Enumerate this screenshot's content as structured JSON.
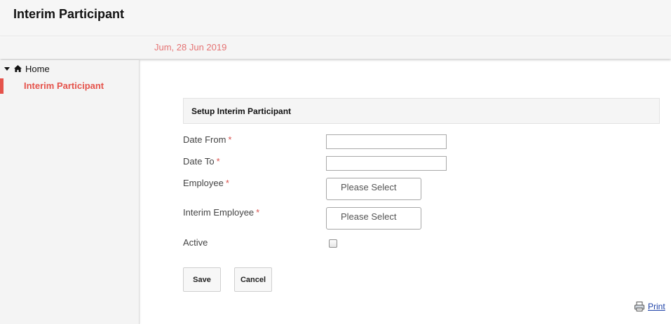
{
  "header": {
    "title": "Interim Participant"
  },
  "subheader": {
    "date": "Jum, 28 Jun 2019"
  },
  "sidebar": {
    "home_label": "Home",
    "items": [
      {
        "label": "Interim Participant",
        "active": true
      }
    ]
  },
  "form": {
    "title": "Setup Interim Participant",
    "required_mark": "*",
    "fields": {
      "date_from": {
        "label": "Date From",
        "value": ""
      },
      "date_to": {
        "label": "Date To",
        "value": ""
      },
      "employee": {
        "label": "Employee",
        "value": "Please Select"
      },
      "interim_employee": {
        "label": "Interim Employee",
        "value": "Please Select"
      },
      "active": {
        "label": "Active",
        "checked": false
      }
    },
    "save_label": "Save",
    "cancel_label": "Cancel"
  },
  "footer": {
    "print_label": "Print"
  },
  "colors": {
    "accent": "#e5534b",
    "date_text": "#e57373",
    "link": "#1a3fa6"
  },
  "icons": {
    "home": "home-icon",
    "print": "printer-icon",
    "caret": "caret-down-icon"
  }
}
